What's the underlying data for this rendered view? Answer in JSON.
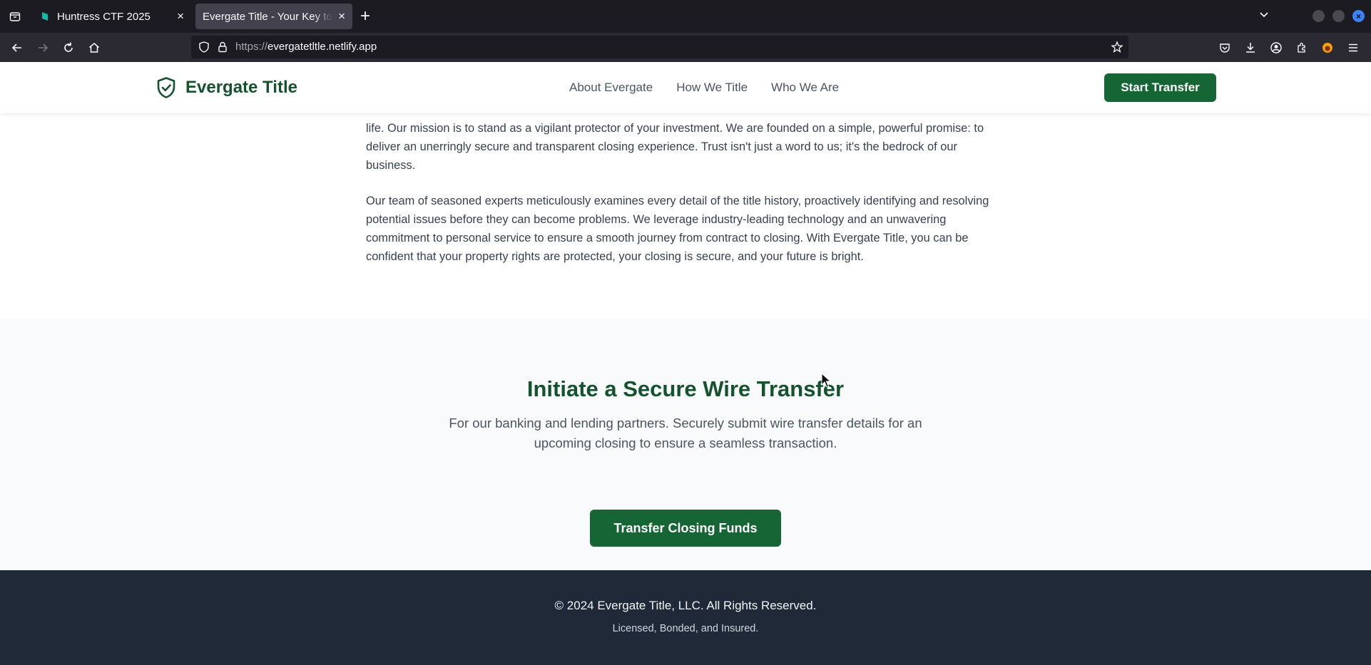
{
  "browser": {
    "tabs": [
      {
        "title": "Huntress CTF 2025",
        "active": false
      },
      {
        "title": "Evergate Title - Your Key to a",
        "active": true
      }
    ],
    "url_scheme": "https://",
    "url_host": "evergatetltle.netlify.app"
  },
  "site": {
    "brand": "Evergate Title",
    "nav": [
      "About Evergate",
      "How We Title",
      "Who We Are"
    ],
    "cta": "Start Transfer"
  },
  "about": {
    "paragraphs": [
      "life. Our mission is to stand as a vigilant protector of your investment. We are founded on a simple, powerful promise: to deliver an unerringly secure and transparent closing experience. Trust isn't just a word to us; it's the bedrock of our business.",
      "Our team of seasoned experts meticulously examines every detail of the title history, proactively identifying and resolving potential issues before they can become problems. We leverage industry-leading technology and an unwavering commitment to personal service to ensure a smooth journey from contract to closing. With Evergate Title, you can be confident that your property rights are protected, your closing is secure, and your future is bright."
    ]
  },
  "wire": {
    "title": "Initiate a Secure Wire Transfer",
    "description": "For our banking and lending partners. Securely submit wire transfer details for an upcoming closing to ensure a seamless transaction.",
    "button": "Transfer Closing Funds"
  },
  "footer": {
    "copyright": "© 2024 Evergate Title, LLC. All Rights Reserved.",
    "tagline": "Licensed, Bonded, and Insured."
  },
  "colors": {
    "brand_green": "#166534",
    "heading_green": "#14532d",
    "footer_bg": "#1f2937"
  }
}
